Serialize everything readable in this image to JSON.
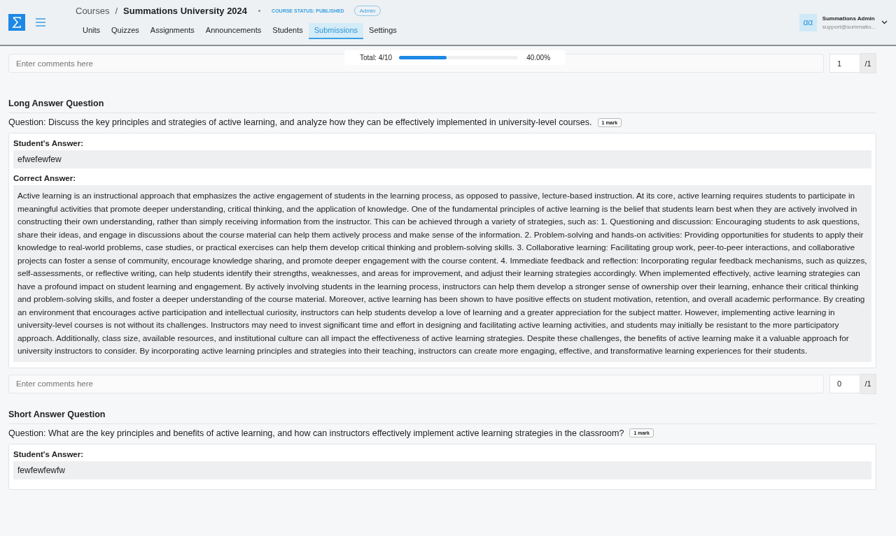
{
  "header": {
    "breadcrumb": "Courses",
    "separator": "/",
    "course_title": "Summations University 2024",
    "status": "COURSE STATUS: PUBLISHED",
    "role_badge": "Admin",
    "tabs": [
      {
        "label": "Units",
        "selected": false
      },
      {
        "label": "Quizzes",
        "selected": false
      },
      {
        "label": "Assignments",
        "selected": false
      },
      {
        "label": "Announcements",
        "selected": false
      },
      {
        "label": "Students",
        "selected": false
      },
      {
        "label": "Submissions",
        "selected": true
      },
      {
        "label": "Settings",
        "selected": false
      }
    ],
    "user": {
      "avatar": "αα",
      "name": "Summations Admin",
      "email": "support@summatio..."
    }
  },
  "progress": {
    "label": "Total: 4/10",
    "level": 0.4,
    "percent": "40.00%"
  },
  "top_comment": {
    "placeholder": "Enter comments here",
    "score": "1",
    "max": "/1"
  },
  "questions": [
    {
      "heading": "Long Answer Question",
      "question": "Question: Discuss the key principles and strategies of active learning, and analyze how they can be effectively implemented in university-level courses.",
      "marks": "1 mark",
      "student_label": "Student's Answer:",
      "student_answer": "efwefewfew",
      "correct_label": "Correct Answer:",
      "correct_answer": "Active learning is an instructional approach that emphasizes the active engagement of students in the learning process, as opposed to passive, lecture-based instruction. At its core, active learning requires students to participate in meaningful activities that promote deeper understanding, critical thinking, and the application of knowledge. One of the fundamental principles of active learning is the belief that students learn best when they are actively involved in constructing their own understanding, rather than simply receiving information from the instructor. This can be achieved through a variety of strategies, such as: 1. Questioning and discussion: Encouraging students to ask questions, share their ideas, and engage in discussions about the course material can help them actively process and make sense of the information. 2. Problem-solving and hands-on activities: Providing opportunities for students to apply their knowledge to real-world problems, case studies, or practical exercises can help them develop critical thinking and problem-solving skills. 3. Collaborative learning: Facilitating group work, peer-to-peer interactions, and collaborative projects can foster a sense of community, encourage knowledge sharing, and promote deeper engagement with the course content. 4. Immediate feedback and reflection: Incorporating regular feedback mechanisms, such as quizzes, self-assessments, or reflective writing, can help students identify their strengths, weaknesses, and areas for improvement, and adjust their learning strategies accordingly. When implemented effectively, active learning strategies can have a profound impact on student learning and engagement. By actively involving students in the learning process, instructors can help them develop a stronger sense of ownership over their learning, enhance their critical thinking and problem-solving skills, and foster a deeper understanding of the course material. Moreover, active learning has been shown to have positive effects on student motivation, retention, and overall academic performance. By creating an environment that encourages active participation and intellectual curiosity, instructors can help students develop a love of learning and a greater appreciation for the subject matter. However, implementing active learning in university-level courses is not without its challenges. Instructors may need to invest significant time and effort in designing and facilitating active learning activities, and students may initially be resistant to the more participatory approach. Additionally, class size, available resources, and institutional culture can all impact the effectiveness of active learning strategies. Despite these challenges, the benefits of active learning make it a valuable approach for university instructors to consider. By incorporating active learning principles and strategies into their teaching, instructors can create more engaging, effective, and transformative learning experiences for their students.",
      "comment": {
        "placeholder": "Enter comments here",
        "score": "0",
        "max": "/1"
      }
    },
    {
      "heading": "Short Answer Question",
      "question": "Question: What are the key principles and benefits of active learning, and how can instructors effectively implement active learning strategies in the classroom?",
      "marks": "1 mark",
      "student_label": "Student's Answer:",
      "student_answer": "fewfewfewfw"
    }
  ]
}
